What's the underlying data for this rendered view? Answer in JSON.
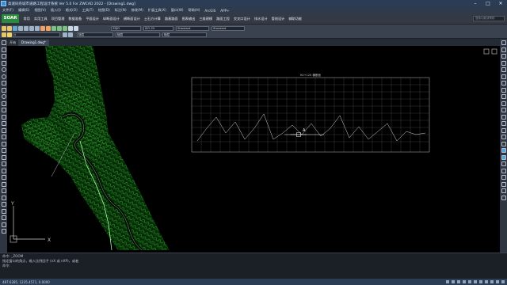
{
  "window": {
    "title": "高速同舟城市道路工程设计系统 Ver 5.0 For ZWCAD 2022 - [Drawing1.dwg]"
  },
  "menu": [
    "文件(F)",
    "编辑(E)",
    "视图(V)",
    "插入(I)",
    "格式(O)",
    "工具(T)",
    "绘图(D)",
    "标注(N)",
    "修改(M)",
    "扩展工具(X)",
    "窗口(W)",
    "帮助(H)",
    "ArcGIS",
    "APP+"
  ],
  "ribbon": {
    "logo": "SOAR",
    "tabs": [
      "常用",
      "实用工具",
      "项目管理",
      "数据准备",
      "平面设计",
      "纵断面设计",
      "横断面设计",
      "土石方计算",
      "路基路面",
      "图表输出",
      "三维建模",
      "路面工程",
      "交叉口设计",
      "排水设计",
      "管线设计",
      "辅助功能"
    ],
    "search_placeholder": "搜索功能或帮助"
  },
  "toolbar": {
    "layer_combo": "0",
    "color_combo": "随层",
    "linetype_combo": "随层",
    "lineweight_combo": "随层",
    "style1": "ZDJD",
    "style2": "ISO-25",
    "style3": "Standard",
    "style4": "Standard"
  },
  "tabs": [
    {
      "label": "开始"
    },
    {
      "label": "Drawing1.dwg*"
    }
  ],
  "canvas": {
    "profile_title": "K0+120 横断面",
    "ucs_y": "Y",
    "ucs_x": "X"
  },
  "cmdline": {
    "lines": [
      "命令: _ZOOM",
      "指定窗口的角点，输入比例因子 (nX 或 nXP)，或者",
      "命令:"
    ]
  },
  "status": {
    "coords": "487.6285, 1235.4571, 0.0000"
  }
}
